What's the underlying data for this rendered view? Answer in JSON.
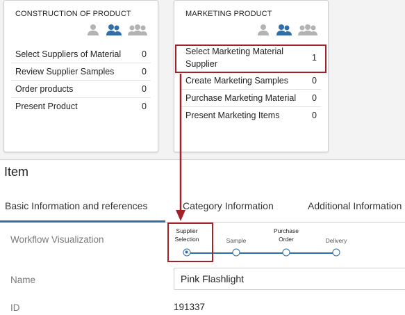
{
  "cards": {
    "construction": {
      "title": "CONSTRUCTION OF PRODUCT",
      "tasks": [
        {
          "label": "Select Suppliers of Material",
          "count": "0"
        },
        {
          "label": "Review Supplier Samples",
          "count": "0"
        },
        {
          "label": "Order products",
          "count": "0"
        },
        {
          "label": "Present Product",
          "count": "0"
        }
      ]
    },
    "marketing": {
      "title": "MARKETING PRODUCT",
      "tasks": [
        {
          "label": "Select Marketing Material Supplier",
          "count": "1"
        },
        {
          "label": "Create Marketing Samples",
          "count": "0"
        },
        {
          "label": "Purchase Marketing Material",
          "count": "0"
        },
        {
          "label": "Present Marketing Items",
          "count": "0"
        }
      ]
    },
    "icons": [
      "single-user-icon",
      "two-users-icon",
      "group-users-icon"
    ]
  },
  "item": {
    "title": "Item",
    "tabs": [
      {
        "label": "Basic Information and references"
      },
      {
        "label": "Category Information"
      },
      {
        "label": "Additional Information"
      }
    ],
    "workflow": {
      "label": "Workflow Visualization",
      "steps": [
        {
          "label": "Supplier Selection",
          "state": "current"
        },
        {
          "label": "Sample",
          "state": "pending"
        },
        {
          "label": "Purchase Order",
          "state": "pending"
        },
        {
          "label": "Delivery",
          "state": "pending"
        }
      ]
    },
    "name": {
      "label": "Name",
      "value": "Pink Flashlight"
    },
    "id": {
      "label": "ID",
      "value": "191337"
    }
  },
  "colors": {
    "accent": "#2f6ea8",
    "highlight": "#a3222a",
    "icon_gray": "#b3b3b3"
  }
}
